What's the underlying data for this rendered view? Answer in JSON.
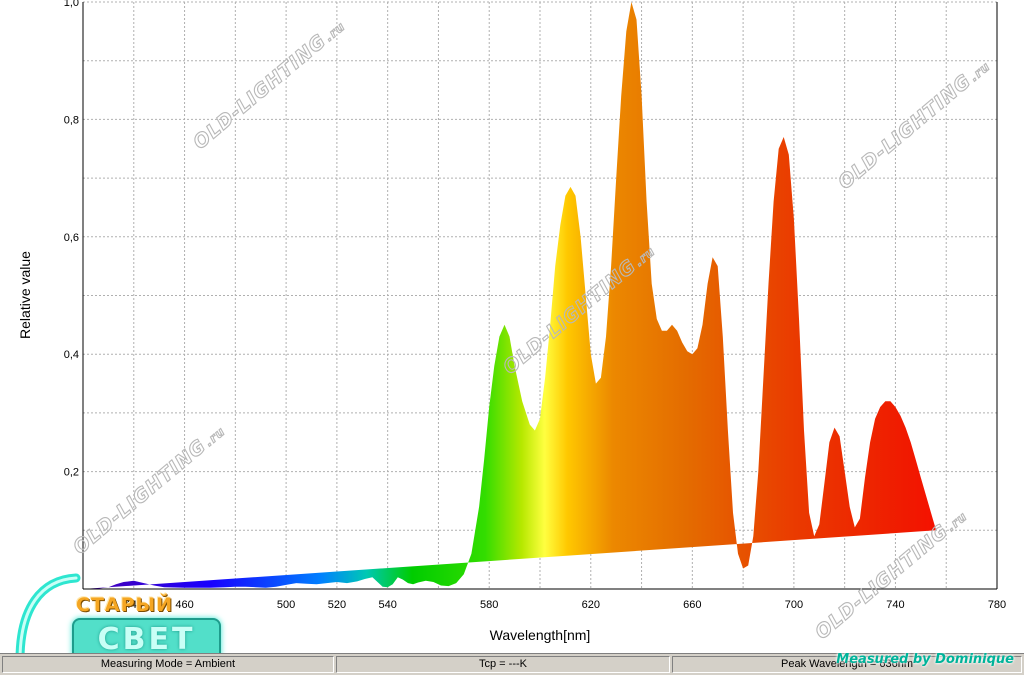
{
  "chart_data": {
    "type": "area",
    "xlabel": "Wavelength[nm]",
    "ylabel": "Relative value",
    "xlim": [
      420,
      780
    ],
    "ylim": [
      0,
      1.0
    ],
    "x_ticks": [
      "440",
      "460",
      "500",
      "520",
      "540",
      "580",
      "620",
      "660",
      "700",
      "740",
      "780"
    ],
    "y_ticks": [
      "0,2",
      "0,4",
      "0,6",
      "0,8",
      "1,0"
    ],
    "grid": true,
    "fill": "spectral colour gradient (violet to red)",
    "x": [
      420,
      425,
      430,
      433,
      436,
      440,
      444,
      448,
      452,
      460,
      470,
      476,
      480,
      484,
      488,
      492,
      496,
      500,
      504,
      508,
      512,
      516,
      520,
      524,
      528,
      531,
      534,
      536,
      538,
      540,
      542,
      544,
      546,
      548,
      550,
      552,
      555,
      558,
      561,
      564,
      567,
      570,
      573,
      576,
      578,
      580,
      582,
      584,
      586,
      588,
      590,
      593,
      596,
      598,
      600,
      602,
      604,
      606,
      608,
      610,
      612,
      614,
      616,
      618,
      620,
      622,
      624,
      626,
      628,
      630,
      632,
      634,
      636,
      638,
      640,
      642,
      644,
      646,
      648,
      650,
      652,
      654,
      656,
      658,
      660,
      662,
      664,
      666,
      668,
      670,
      672,
      674,
      676,
      678,
      680,
      682,
      684,
      686,
      688,
      690,
      692,
      694,
      696,
      698,
      700,
      702,
      704,
      706,
      708,
      710,
      712,
      714,
      716,
      718,
      720,
      722,
      724,
      726,
      728,
      730,
      732,
      734,
      736,
      738,
      740,
      742,
      744,
      746,
      748,
      750,
      752,
      754,
      756,
      758,
      760,
      762,
      764,
      766,
      768,
      770,
      772,
      774,
      776,
      778,
      780
    ],
    "values": [
      0.0,
      0.0,
      0.003,
      0.008,
      0.012,
      0.014,
      0.01,
      0.006,
      0.003,
      0.002,
      0.002,
      0.003,
      0.004,
      0.004,
      0.003,
      0.002,
      0.004,
      0.007,
      0.01,
      0.009,
      0.008,
      0.01,
      0.012,
      0.01,
      0.013,
      0.017,
      0.02,
      0.012,
      0.004,
      0.003,
      0.008,
      0.02,
      0.016,
      0.01,
      0.008,
      0.011,
      0.014,
      0.012,
      0.006,
      0.005,
      0.01,
      0.025,
      0.06,
      0.14,
      0.22,
      0.31,
      0.38,
      0.43,
      0.45,
      0.43,
      0.38,
      0.32,
      0.28,
      0.27,
      0.29,
      0.36,
      0.45,
      0.55,
      0.62,
      0.67,
      0.685,
      0.67,
      0.6,
      0.5,
      0.4,
      0.35,
      0.36,
      0.43,
      0.55,
      0.7,
      0.84,
      0.95,
      1.0,
      0.97,
      0.84,
      0.66,
      0.52,
      0.46,
      0.44,
      0.44,
      0.45,
      0.44,
      0.42,
      0.405,
      0.4,
      0.41,
      0.45,
      0.52,
      0.565,
      0.55,
      0.43,
      0.27,
      0.13,
      0.06,
      0.035,
      0.04,
      0.09,
      0.2,
      0.36,
      0.52,
      0.66,
      0.75,
      0.77,
      0.74,
      0.63,
      0.46,
      0.27,
      0.13,
      0.09,
      0.11,
      0.18,
      0.25,
      0.275,
      0.26,
      0.2,
      0.14,
      0.105,
      0.12,
      0.19,
      0.25,
      0.29,
      0.31,
      0.32,
      0.32,
      0.31,
      0.295,
      0.275,
      0.25,
      0.22,
      0.19,
      0.16,
      0.13,
      0.1
    ]
  },
  "status_bar": {
    "measuring_mode": "Measuring Mode = Ambient",
    "tcp": "Tcp = ---K",
    "peak": "Peak Wavelength = 636nm"
  },
  "credit": "Measured by Dominique",
  "watermark_text": "OLD-LIGHTING",
  "watermark_suffix": ".ru",
  "logo": {
    "top_text": "СТАРЫЙ",
    "bottom_text": "СВЕТ"
  },
  "colors": {
    "grid": "#b0b0b0",
    "status_bar": "#d4d0c8",
    "credit": "#00b39a",
    "logo_teal": "#52dfc9",
    "logo_orange": "#f5a623"
  }
}
